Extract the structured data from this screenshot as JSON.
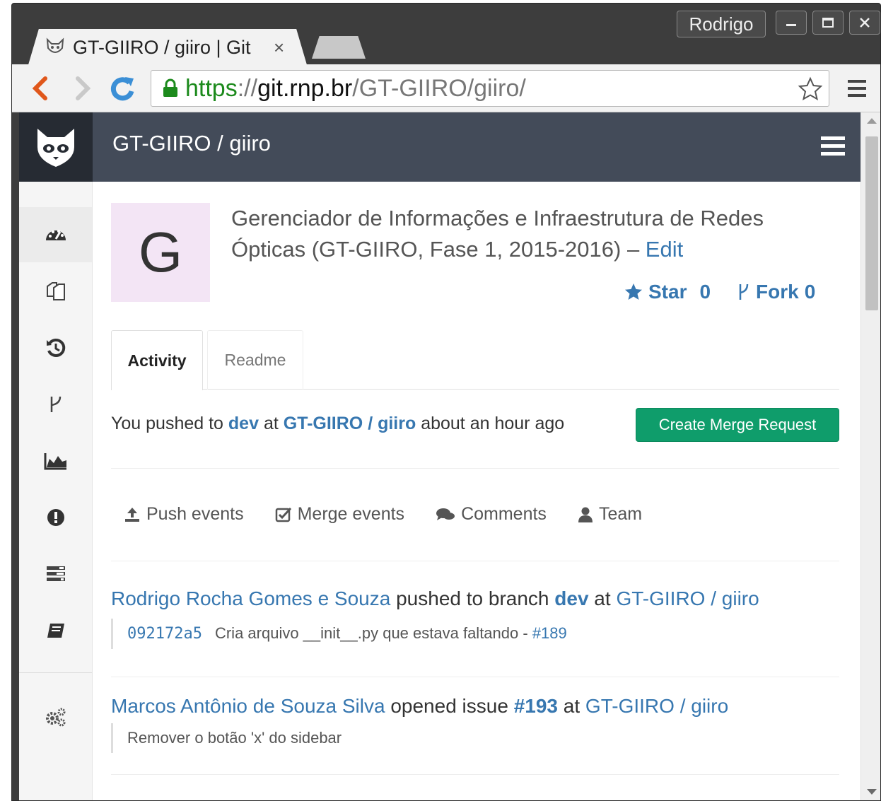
{
  "browser": {
    "tab_title": "GT-GIIRO / giiro | Git",
    "tab_close": "×",
    "profile_name": "Rodrigo",
    "url_scheme": "https",
    "url_sep": "://",
    "url_host": "git.rnp.br",
    "url_path": "/GT-GIIRO/giiro/"
  },
  "header": {
    "title": "GT-GIIRO / giiro"
  },
  "sidebar": {
    "items": [
      {
        "icon": "dashboard-icon",
        "active": true
      },
      {
        "icon": "files-icon"
      },
      {
        "icon": "history-icon"
      },
      {
        "icon": "branch-icon"
      },
      {
        "icon": "graph-icon"
      },
      {
        "icon": "issues-icon"
      },
      {
        "icon": "merge-requests-icon"
      },
      {
        "icon": "wiki-icon"
      },
      {
        "icon": "settings-icon"
      }
    ]
  },
  "project": {
    "avatar_letter": "G",
    "description": "Gerenciador de Informações e Infraestrutura de Redes Ópticas (GT-GIIRO, Fase 1, 2015-2016) – ",
    "edit_label": "Edit",
    "star_label": "Star",
    "star_count": "0",
    "fork_label": "Fork",
    "fork_count": "0"
  },
  "tabs": [
    {
      "label": "Activity",
      "active": true
    },
    {
      "label": "Readme",
      "active": false
    }
  ],
  "push_notice": {
    "prefix": "You pushed to ",
    "branch": "dev",
    "mid": " at ",
    "project": "GT-GIIRO / giiro",
    "suffix": " about an hour ago",
    "button_label": "Create Merge Request"
  },
  "filters": [
    {
      "label": "Push events",
      "icon": "upload-icon"
    },
    {
      "label": "Merge events",
      "icon": "check-square-icon"
    },
    {
      "label": "Comments",
      "icon": "comments-icon"
    },
    {
      "label": "Team",
      "icon": "user-icon"
    }
  ],
  "events": [
    {
      "author": "Rodrigo Rocha Gomes e Souza",
      "action": " pushed to branch ",
      "target": "dev",
      "at": " at ",
      "project": "GT-GIIRO / giiro",
      "sha": "092172a5",
      "message": "Cria arquivo __init__.py que estava faltando - ",
      "ref": "#189"
    },
    {
      "author": "Marcos Antônio de Souza Silva",
      "action": " opened issue ",
      "target": "#193",
      "at": " at ",
      "project": "GT-GIIRO / giiro",
      "message": "Remover o botão 'x' do sidebar"
    }
  ],
  "colors": {
    "header_bg": "#434b59",
    "link": "#3777b0",
    "button_green": "#0f9d6b",
    "avatar_bg": "#f3e5f5"
  }
}
